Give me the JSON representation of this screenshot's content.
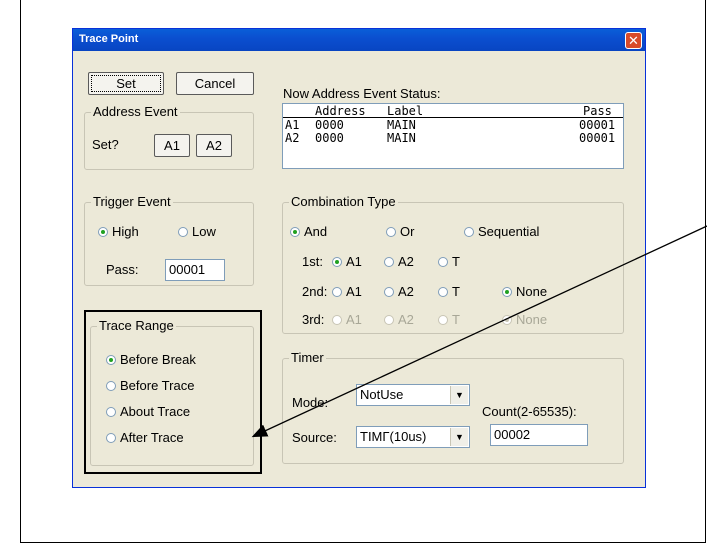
{
  "dialog": {
    "title": "Trace Point",
    "close_label": "✕"
  },
  "buttons": {
    "set": "Set",
    "cancel": "Cancel"
  },
  "address_event": {
    "legend": "Address Event",
    "set_label": "Set?",
    "a1": "A1",
    "a2": "A2"
  },
  "status": {
    "label": "Now Address Event Status:",
    "headers": {
      "address": "Address",
      "label": "Label",
      "pass": "Pass"
    },
    "rows": [
      {
        "id": "A1",
        "address": "0000",
        "label": "MAIN",
        "pass": "00001"
      },
      {
        "id": "A2",
        "address": "0000",
        "label": "MAIN",
        "pass": "00001"
      }
    ]
  },
  "trigger": {
    "legend": "Trigger Event",
    "high": "High",
    "low": "Low",
    "selected": "High",
    "pass_label": "Pass:",
    "pass_value": "00001"
  },
  "combination": {
    "legend": "Combination Type",
    "and": "And",
    "or": "Or",
    "sequential": "Sequential",
    "selected": "And",
    "first_label": "1st:",
    "second_label": "2nd:",
    "third_label": "3rd:",
    "a1": "A1",
    "a2": "A2",
    "t": "T",
    "none": "None"
  },
  "trace_range": {
    "legend": "Trace Range",
    "options": [
      "Before Break",
      "Before Trace",
      "About Trace",
      "After Trace"
    ],
    "selected": "Before Break"
  },
  "timer": {
    "legend": "Timer",
    "mode_label": "Mode:",
    "mode_value": "NotUse",
    "source_label": "Source:",
    "source_value": "TIMΓ(10us)",
    "count_label": "Count(2-65535):",
    "count_value": "00002"
  }
}
